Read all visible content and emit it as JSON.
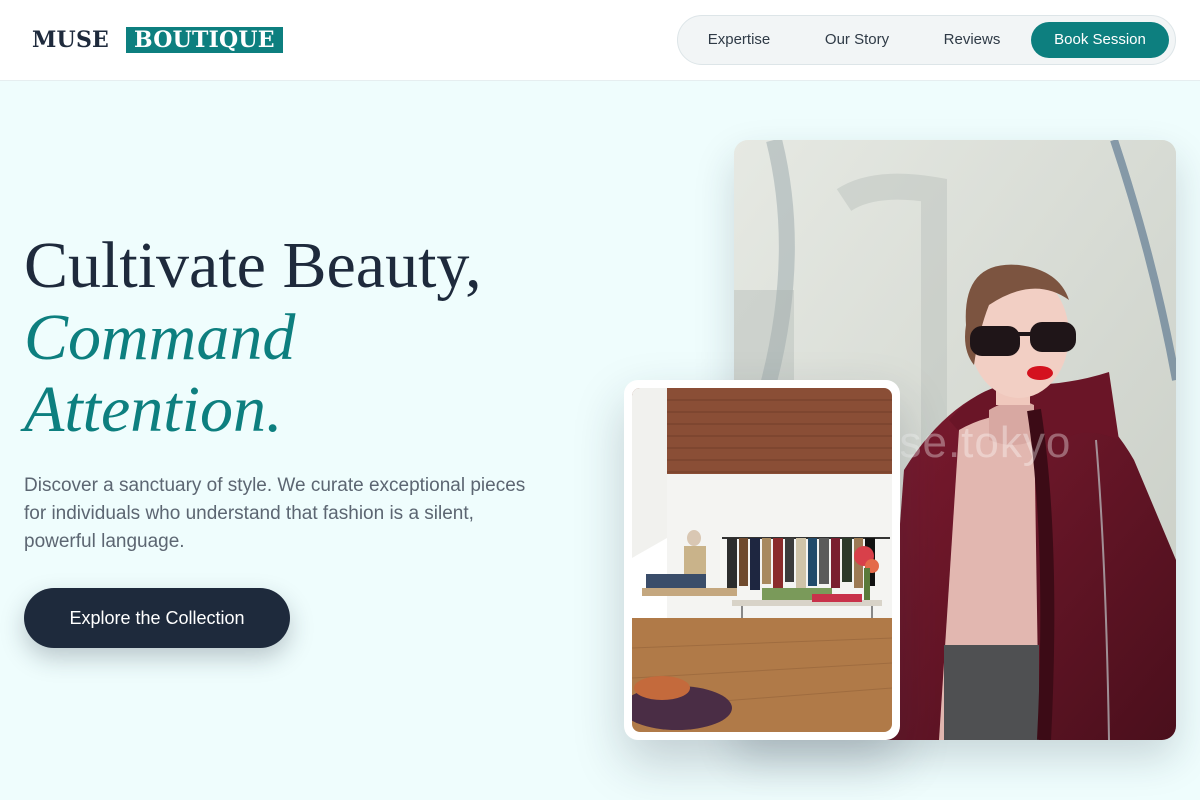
{
  "brand": {
    "name_part1": "MUSE",
    "name_part2": "BOUTIQUE"
  },
  "nav": {
    "links": [
      {
        "label": "Expertise"
      },
      {
        "label": "Our Story"
      },
      {
        "label": "Reviews"
      }
    ],
    "book_label": "Book Session"
  },
  "hero": {
    "title_line1": "Cultivate Beauty,",
    "title_line2": "Command",
    "title_line3": "Attention.",
    "description": "Discover a sanctuary of style. We curate exceptional pieces for individuals who understand that fashion is a silent, powerful language.",
    "cta_label": "Explore the Collection"
  },
  "images": {
    "main_watermark": "ese.tokyo",
    "main_subject": "woman-in-sunglasses-photo",
    "store_subject": "boutique-interior-photo"
  },
  "colors": {
    "accent": "#0d7f7f",
    "dark": "#1e2a3c",
    "background": "#effdfd"
  }
}
